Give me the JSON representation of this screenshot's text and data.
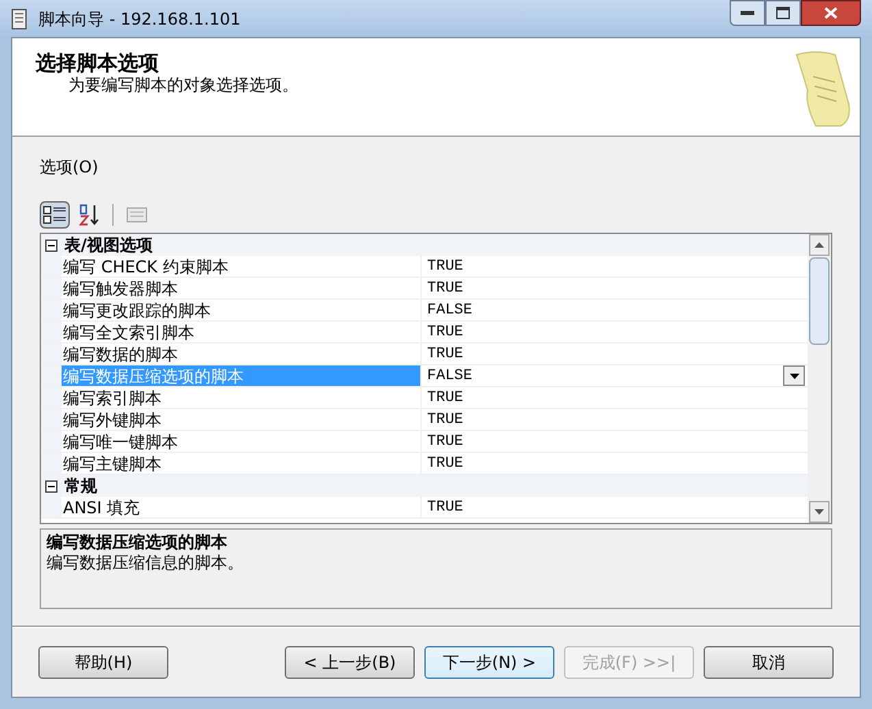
{
  "window": {
    "title": "脚本向导 - 192.168.1.101"
  },
  "header": {
    "title": "选择脚本选项",
    "subtitle": "为要编写脚本的对象选择选项。"
  },
  "options_label": "选项(O)",
  "toolbar": [
    {
      "kind": "categorized",
      "selected": true
    },
    {
      "kind": "alphabetical",
      "selected": false
    },
    {
      "kind": "pages",
      "selected": false
    }
  ],
  "grid": {
    "categories": [
      {
        "name": "表/视图选项",
        "expanded": true,
        "rows": [
          {
            "name": "编写 CHECK 约束脚本",
            "value": "TRUE",
            "selected": false
          },
          {
            "name": "编写触发器脚本",
            "value": "TRUE",
            "selected": false
          },
          {
            "name": "编写更改跟踪的脚本",
            "value": "FALSE",
            "selected": false
          },
          {
            "name": "编写全文索引脚本",
            "value": "TRUE",
            "selected": false
          },
          {
            "name": "编写数据的脚本",
            "value": "TRUE",
            "selected": false
          },
          {
            "name": "编写数据压缩选项的脚本",
            "value": "FALSE",
            "selected": true
          },
          {
            "name": "编写索引脚本",
            "value": "TRUE",
            "selected": false
          },
          {
            "name": "编写外键脚本",
            "value": "TRUE",
            "selected": false
          },
          {
            "name": "编写唯一键脚本",
            "value": "TRUE",
            "selected": false
          },
          {
            "name": "编写主键脚本",
            "value": "TRUE",
            "selected": false
          }
        ]
      },
      {
        "name": "常规",
        "expanded": true,
        "rows": [
          {
            "name": "ANSI 填充",
            "value": "TRUE",
            "selected": false
          }
        ]
      }
    ]
  },
  "description": {
    "title": "编写数据压缩选项的脚本",
    "text": "编写数据压缩信息的脚本。"
  },
  "buttons": [
    {
      "label": "帮助(H)",
      "disabled": false
    },
    {
      "label": "< 上一步(B)",
      "disabled": false
    },
    {
      "label": "下一步(N) >",
      "disabled": false,
      "default": true
    },
    {
      "label": "完成(F) >>|",
      "disabled": true
    },
    {
      "label": "取消",
      "disabled": false
    }
  ]
}
